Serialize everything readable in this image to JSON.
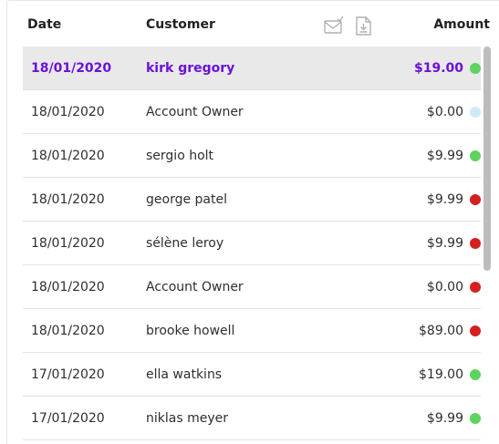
{
  "header": {
    "date": "Date",
    "customer": "Customer",
    "amount": "Amount",
    "icons": [
      "email-check-icon",
      "download-file-icon"
    ]
  },
  "rows": [
    {
      "date": "18/01/2020",
      "customer": "kirk gregory",
      "amount": "$19.00",
      "status": "green",
      "selected": true
    },
    {
      "date": "18/01/2020",
      "customer": "Account Owner",
      "amount": "$0.00",
      "status": "lightblue",
      "selected": false
    },
    {
      "date": "18/01/2020",
      "customer": "sergio holt",
      "amount": "$9.99",
      "status": "green",
      "selected": false
    },
    {
      "date": "18/01/2020",
      "customer": "george patel",
      "amount": "$9.99",
      "status": "red",
      "selected": false
    },
    {
      "date": "18/01/2020",
      "customer": "sélène leroy",
      "amount": "$9.99",
      "status": "red",
      "selected": false
    },
    {
      "date": "18/01/2020",
      "customer": "Account Owner",
      "amount": "$0.00",
      "status": "red",
      "selected": false
    },
    {
      "date": "18/01/2020",
      "customer": "brooke howell",
      "amount": "$89.00",
      "status": "red",
      "selected": false
    },
    {
      "date": "17/01/2020",
      "customer": "ella watkins",
      "amount": "$19.00",
      "status": "green",
      "selected": false
    },
    {
      "date": "17/01/2020",
      "customer": "niklas meyer",
      "amount": "$9.99",
      "status": "green",
      "selected": false
    }
  ],
  "colors": {
    "green": "#5fd35f",
    "red": "#d42020",
    "lightblue": "#cdebf5",
    "selected_text": "#6a12d4"
  }
}
